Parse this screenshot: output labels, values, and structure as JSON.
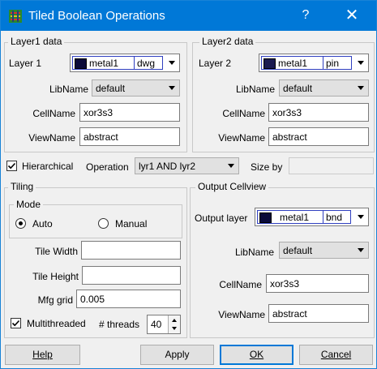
{
  "window": {
    "title": "Tiled Boolean Operations",
    "help_glyph": "?",
    "close_glyph": "✕"
  },
  "layer1": {
    "group_title": "Layer1 data",
    "layer_label": "Layer 1",
    "layer_name": "metal1",
    "purpose": "dwg",
    "libname_label": "LibName",
    "libname_value": "default",
    "cellname_label": "CellName",
    "cellname_value": "xor3s3",
    "viewname_label": "ViewName",
    "viewname_value": "abstract"
  },
  "layer2": {
    "group_title": "Layer2 data",
    "layer_label": "Layer 2",
    "layer_name": "metal1",
    "purpose": "pin",
    "libname_label": "LibName",
    "libname_value": "default",
    "cellname_label": "CellName",
    "cellname_value": "xor3s3",
    "viewname_label": "ViewName",
    "viewname_value": "abstract"
  },
  "options": {
    "hierarchical_label": "Hierarchical",
    "hierarchical_checked": true,
    "operation_label": "Operation",
    "operation_value": "lyr1 AND lyr2",
    "sizeby_label": "Size by",
    "sizeby_value": ""
  },
  "tiling": {
    "group_title": "Tiling",
    "mode_title": "Mode",
    "auto_label": "Auto",
    "manual_label": "Manual",
    "selected_mode": "Auto",
    "tile_width_label": "Tile Width",
    "tile_width_value": "",
    "tile_height_label": "Tile Height",
    "tile_height_value": "",
    "mfg_grid_label": "Mfg grid",
    "mfg_grid_value": "0.005",
    "multithreaded_label": "Multithreaded",
    "multithreaded_checked": true,
    "threads_label": "# threads",
    "threads_value": "40"
  },
  "output": {
    "group_title": "Output Cellview",
    "layer_label": "Output layer",
    "layer_name": "metal1",
    "purpose": "bnd",
    "libname_label": "LibName",
    "libname_value": "default",
    "cellname_label": "CellName",
    "cellname_value": "xor3s3",
    "viewname_label": "ViewName",
    "viewname_value": "abstract"
  },
  "buttons": {
    "help_label": "Help",
    "apply_label": "Apply",
    "ok_label": "OK",
    "cancel_label": "Cancel"
  },
  "colors": {
    "titlebar": "#0078d7",
    "layer_combo_border": "#3040c0",
    "swatch_fill": "#0a0a3a"
  }
}
